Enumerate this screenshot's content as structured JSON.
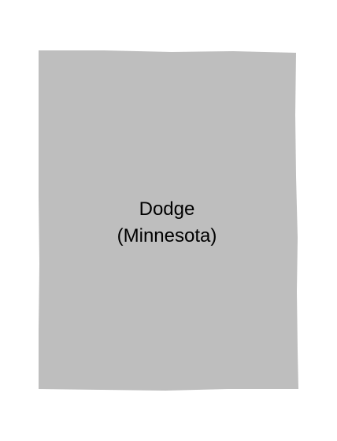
{
  "map": {
    "region": {
      "name": "Dodge",
      "state_line": "(Minnesota)",
      "fill": "#bebebe"
    },
    "background": "#ffffff"
  }
}
